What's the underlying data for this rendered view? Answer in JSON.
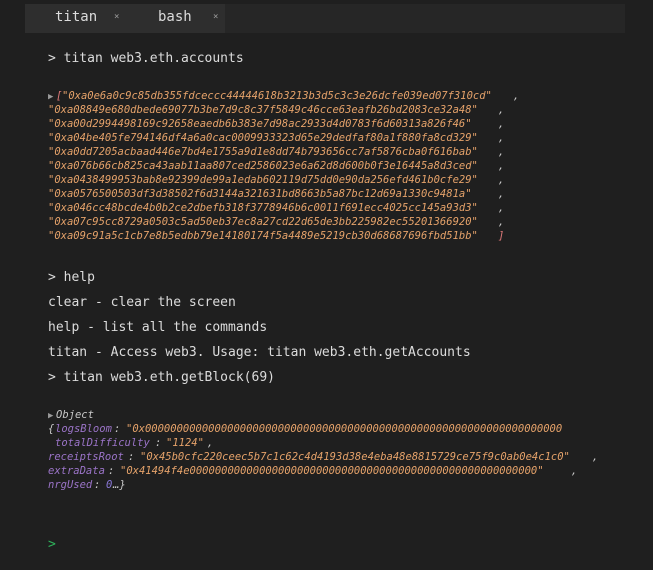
{
  "tabs": [
    {
      "label": "titan",
      "close": "×"
    },
    {
      "label": "bash",
      "close": "×"
    }
  ],
  "commands": {
    "accounts": "> titan web3.eth.accounts",
    "help": "> help",
    "getblock": "> titan web3.eth.getBlock(69)"
  },
  "accounts": [
    "\"0xa0e6a0c9c85db355fdceccc44444618b3213b3d5c3c3e26dcfe039ed07f310cd\"",
    "\"0xa08849e680dbede69077b3be7d9c8c37f5849c46cce63eafb26bd2083ce32a48\"",
    "\"0xa00d2994498169c92658eaedb6b383e7d98ac2933d4d0783f6d60313a826f46\"",
    "\"0xa04be405fe794146df4a6a0cac0009933323d65e29dedfaf80a1f880fa8cd329\"",
    "\"0xa0dd7205acbaad446e7bd4e1755a9d1e8dd74b793656cc7af5876cba0f616bab\"",
    "\"0xa076b66cb825ca43aab11aa807ced2586023e6a62d8d600b0f3e16445a8d3ced\"",
    "\"0xa0438499953bab8e92399de99a1edab602119d75dd0e90da256efd461b0cfe29\"",
    "\"0xa0576500503df3d38502f6d3144a321631bd8663b5a87bc12d69a1330c9481a\"",
    "\"0xa046cc48bcde4b0b2ce2dbefb318f3778946b6c0011f691ecc4025cc145a93d3\"",
    "\"0xa07c95cc8729a0503c5ad50eb37ec8a27cd22d65de3bb225982ec55201366920\"",
    "\"0xa09c91a5c1cb7e8b5edbb79e14180174f5a4489e5219cb30d68687696fbd51bb\""
  ],
  "help_lines": [
    "clear - clear the screen",
    "help - list all the commands",
    "titan - Access web3. Usage: titan web3.eth.getAccounts"
  ],
  "block": {
    "label": "Object",
    "logsBloom_key": "logsBloom",
    "logsBloom_val": "\"0x000000000000000000000000000000000000000000000000000000000000000000",
    "totalDifficulty_key": "totalDifficulty",
    "totalDifficulty_val": "\"1124\"",
    "receiptsRoot_key": "receiptsRoot",
    "receiptsRoot_val": "\"0x45b0cfc220ceec5b7c1c62c4d4193d38e4eba48e8815729ce75f9c0ab0e4c1c0\"",
    "extraData_key": "extraData",
    "extraData_val": "\"0x41494f4e0000000000000000000000000000000000000000000000000000000\"",
    "nrgUsed_key": "nrgUsed",
    "nrgUsed_val": "0",
    "ellipsis": "…}"
  },
  "final_prompt": ">"
}
